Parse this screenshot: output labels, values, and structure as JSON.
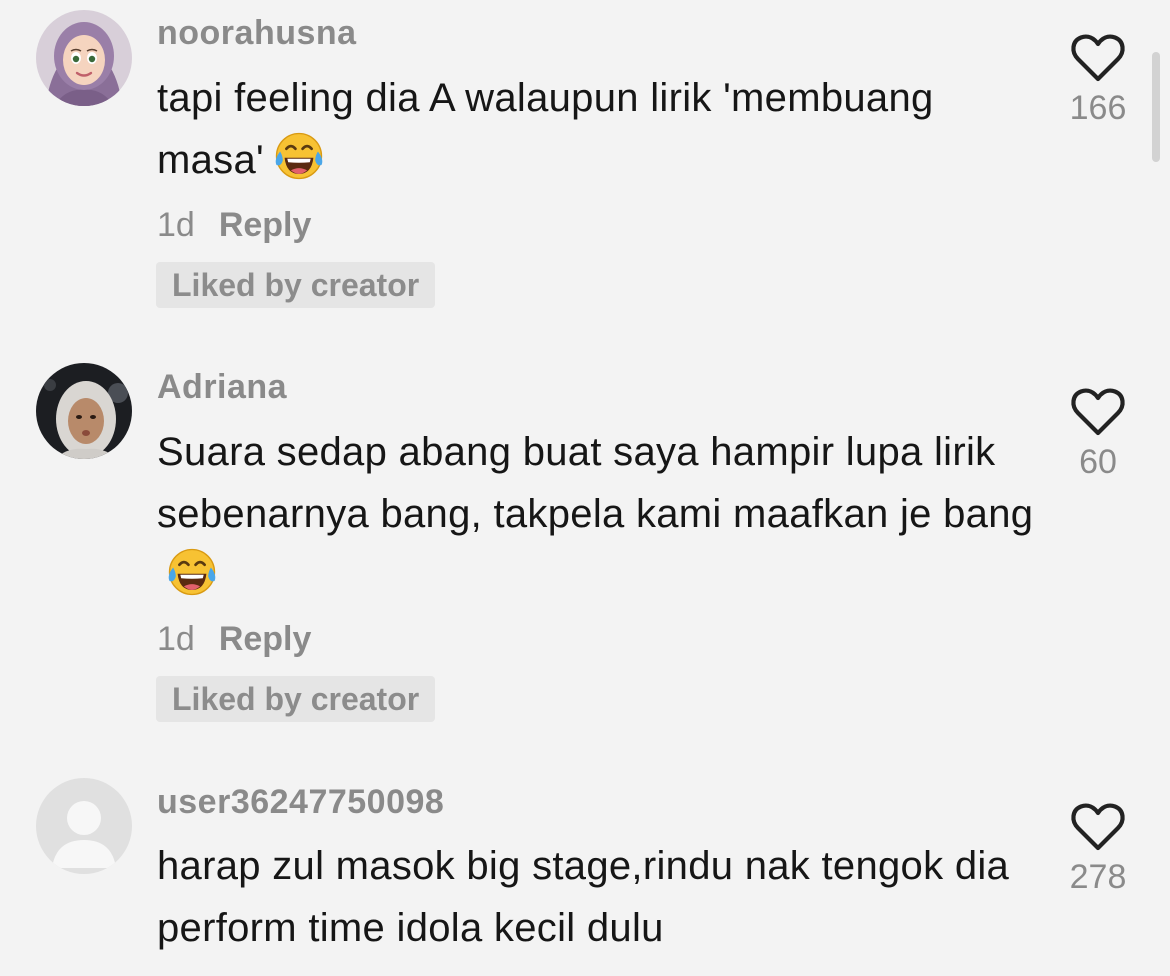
{
  "comments": [
    {
      "username": "noorahusna",
      "text": "tapi feeling dia A walaupun lirik 'membuang masa'",
      "emoji": "face-with-tears-of-joy",
      "time": "1d",
      "reply_label": "Reply",
      "badge": "Liked by creator",
      "likes": "166",
      "avatar": "hijab-cartoon-avatar"
    },
    {
      "username": "Adriana",
      "text": "Suara sedap abang buat saya hampir lupa lirik sebenarnya bang, takpela kami maafkan je bang",
      "emoji": "face-with-tears-of-joy",
      "time": "1d",
      "reply_label": "Reply",
      "badge": "Liked by creator",
      "likes": "60",
      "avatar": "hijab-photo-avatar"
    },
    {
      "username": "user36247750098",
      "text": "harap zul masok big stage,rindu nak tengok dia perform time idola kecil dulu",
      "likes": "278",
      "avatar": "default-person-avatar"
    }
  ],
  "colors": {
    "background": "#f3f3f3",
    "text": "#161616",
    "secondary": "#8a8a8a",
    "badge_bg": "#e5e5e5"
  }
}
